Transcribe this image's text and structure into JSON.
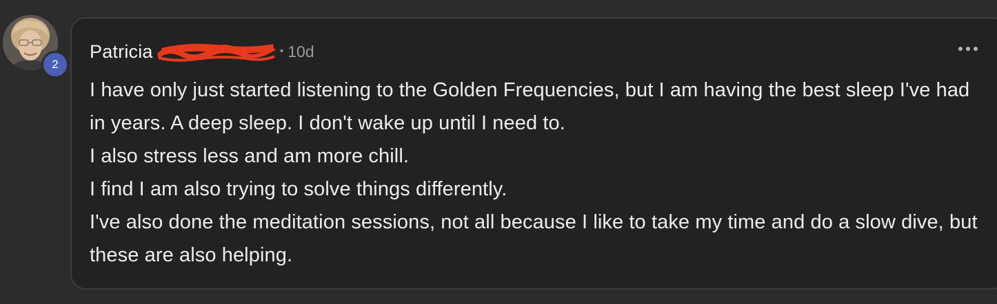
{
  "comment": {
    "author": "Patricia",
    "separator": "•",
    "time": "10d",
    "level": "2",
    "lines": [
      "I have only just started listening to the Golden Frequencies, but I am having the best sleep I've had in years. A deep sleep. I don't wake up until I need to.",
      "I also stress less and am more chill.",
      "I find I am also trying to solve things differently.",
      "I've also done the meditation sessions, not all because I like to take my time and do a slow dive, but these are also helping."
    ]
  },
  "icons": {
    "more": "more-horizontal-icon",
    "avatar": "profile-photo"
  },
  "colors": {
    "background": "#2c2c2c",
    "card": "#222222",
    "badge": "#4b5fb8",
    "redaction": "#e8391c"
  }
}
